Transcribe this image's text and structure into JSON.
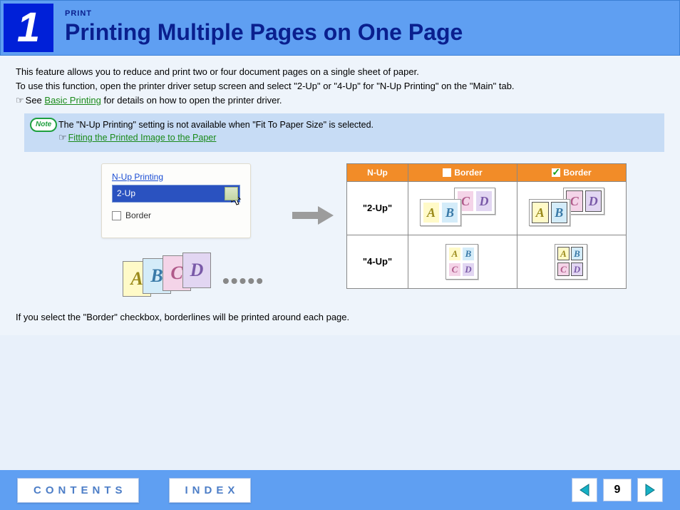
{
  "header": {
    "chapter_number": "1",
    "section": "PRINT",
    "title": "Printing Multiple Pages on One Page"
  },
  "intro": {
    "line1": "This feature allows you to reduce and print two or four document pages on a single sheet of paper.",
    "line2": "To use this function, open the printer driver setup screen and select \"2-Up\" or \"4-Up\" for \"N-Up Printing\" on the \"Main\" tab.",
    "see_prefix": "See ",
    "see_link": "Basic Printing",
    "see_suffix": " for details on how to open the printer driver."
  },
  "note": {
    "badge": "Note",
    "text": "The \"N-Up Printing\" setting is not available when \"Fit To Paper Size\" is selected.",
    "link": "Fitting the Printed Image to the Paper"
  },
  "panel": {
    "group_label": "N-Up Printing",
    "selected": "2-Up",
    "border_label": "Border"
  },
  "pages": {
    "A": "A",
    "B": "B",
    "C": "C",
    "D": "D"
  },
  "table": {
    "col_nup": "N-Up",
    "col_noborder": "Border",
    "col_border": "Border",
    "row_2up": "\"2-Up\"",
    "row_4up": "\"4-Up\""
  },
  "footer_note": "If you select the \"Border\" checkbox, borderlines will be printed around each page.",
  "footer": {
    "contents": "CONTENTS",
    "index": "INDEX",
    "page": "9"
  }
}
